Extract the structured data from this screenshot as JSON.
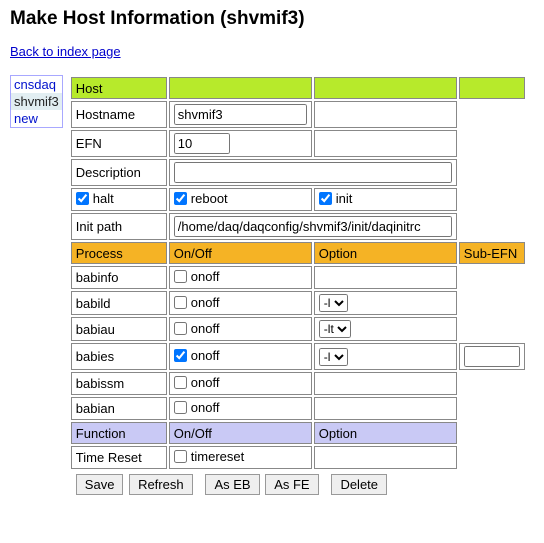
{
  "page": {
    "title": "Make Host Information (shvmif3)",
    "back_link": "Back to index page"
  },
  "sidebar": {
    "items": [
      "cnsdaq",
      "shvmif3",
      "new"
    ],
    "selected_index": 1
  },
  "host_section": {
    "header": "Host",
    "rows": {
      "hostname": {
        "label": "Hostname",
        "value": "shvmif3"
      },
      "efn": {
        "label": "EFN",
        "value": "10"
      },
      "description": {
        "label": "Description",
        "value": ""
      },
      "flags": {
        "halt": {
          "label": "halt",
          "checked": true
        },
        "reboot": {
          "label": "reboot",
          "checked": true
        },
        "init": {
          "label": "init",
          "checked": true
        }
      },
      "init_path": {
        "label": "Init path",
        "value": "/home/daq/daqconfig/shvmif3/init/daqinitrc"
      }
    }
  },
  "process_section": {
    "headers": {
      "proc": "Process",
      "onoff": "On/Off",
      "option": "Option",
      "subefn": "Sub-EFN"
    },
    "rows": [
      {
        "name": "babinfo",
        "onoff": false,
        "onoff_label": "onoff",
        "option": null,
        "subefn": null
      },
      {
        "name": "babild",
        "onoff": false,
        "onoff_label": "onoff",
        "option": "-l",
        "subefn": null
      },
      {
        "name": "babiau",
        "onoff": false,
        "onoff_label": "onoff",
        "option": "-lt",
        "subefn": null
      },
      {
        "name": "babies",
        "onoff": true,
        "onoff_label": "onoff",
        "option": "-l",
        "subefn": ""
      },
      {
        "name": "babissm",
        "onoff": false,
        "onoff_label": "onoff",
        "option": null,
        "subefn": null
      },
      {
        "name": "babian",
        "onoff": false,
        "onoff_label": "onoff",
        "option": null,
        "subefn": null
      }
    ]
  },
  "function_section": {
    "headers": {
      "func": "Function",
      "onoff": "On/Off",
      "option": "Option"
    },
    "rows": [
      {
        "name": "Time Reset",
        "onoff": false,
        "onoff_label": "timereset"
      }
    ]
  },
  "buttons": {
    "save": "Save",
    "refresh": "Refresh",
    "as_eb": "As EB",
    "as_fe": "As FE",
    "delete": "Delete"
  }
}
